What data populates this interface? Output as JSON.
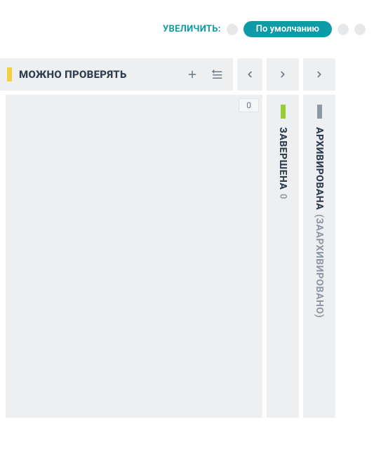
{
  "zoom": {
    "label": "УВЕЛИЧИТЬ:",
    "default_pill": "По умолчанию"
  },
  "columns": {
    "expanded": {
      "title": "МОЖНО ПРОВЕРЯТЬ",
      "count": "0",
      "chip_color": "#f4d03f"
    },
    "collapsed": [
      {
        "title": "ЗАВЕРШЕНА",
        "count": "0",
        "subtitle": "",
        "chip_class": "chip-green"
      },
      {
        "title": "АРХИВИРОВАНА",
        "count": "",
        "subtitle": "(ЗААРХИВИРОВАНО)",
        "chip_class": "chip-gray"
      }
    ]
  }
}
